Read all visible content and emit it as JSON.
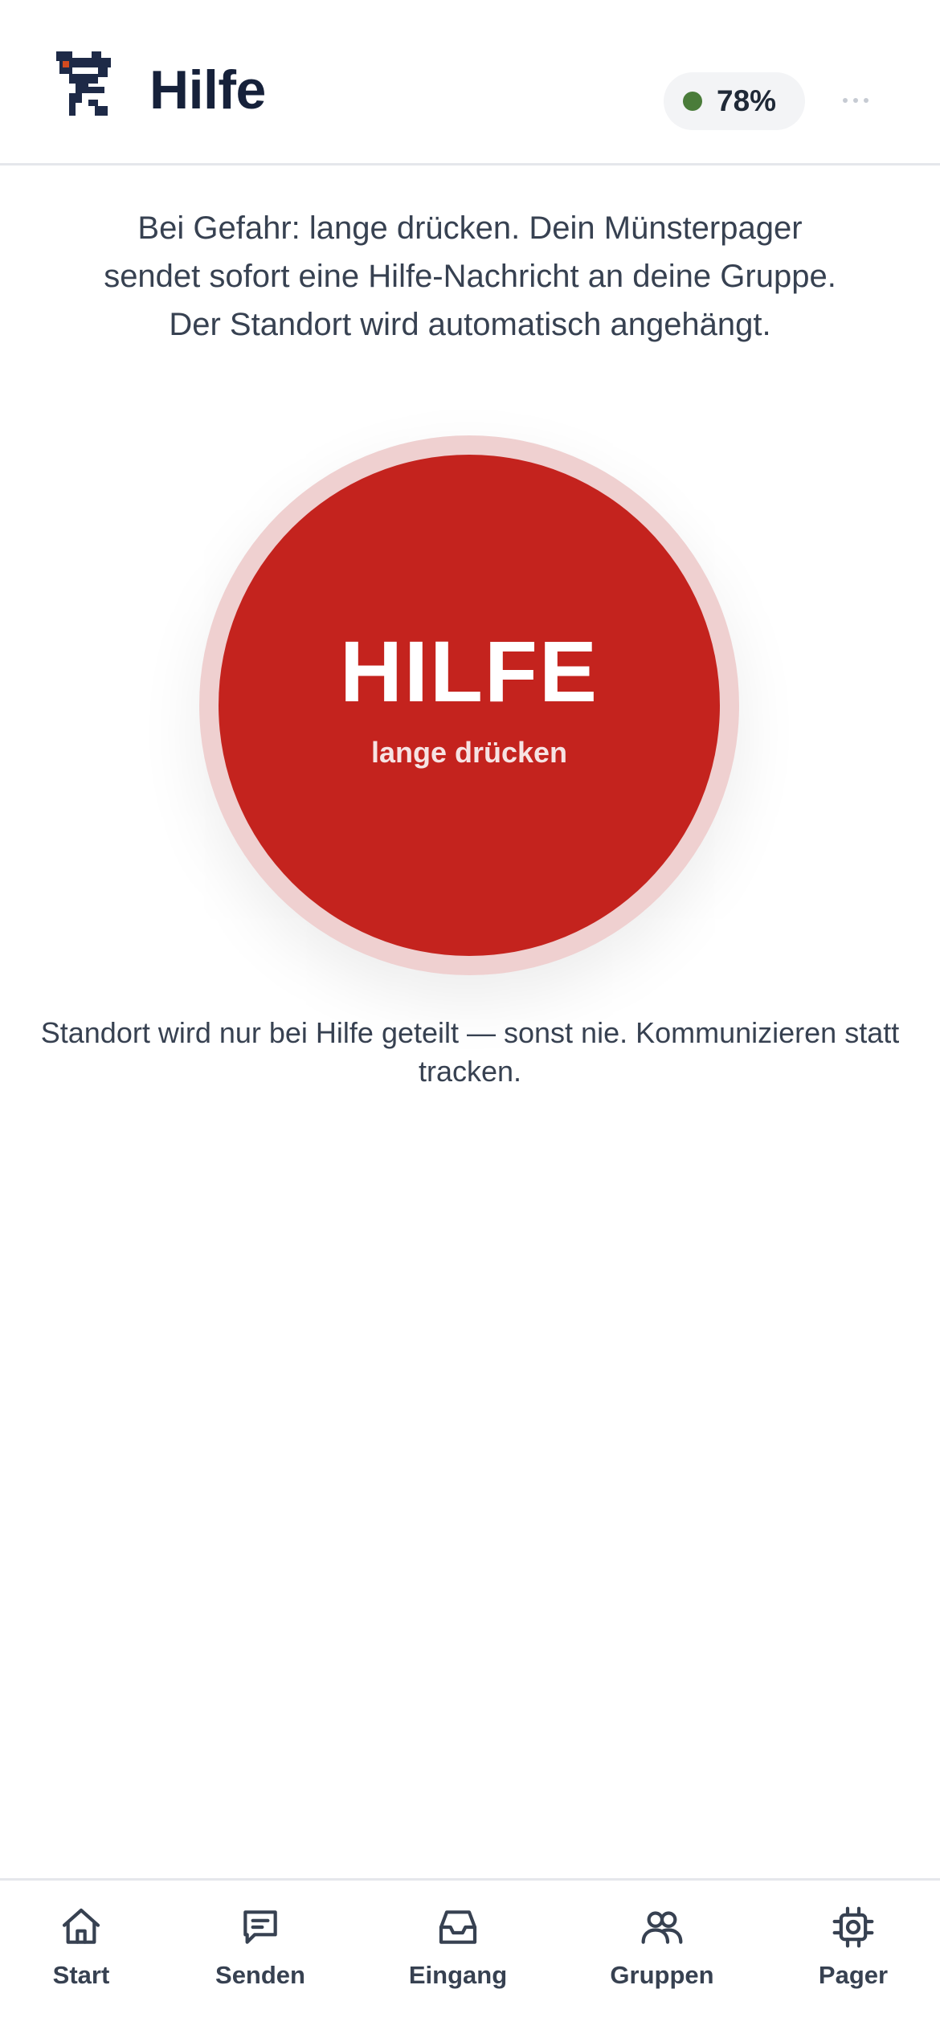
{
  "header": {
    "title": "Hilfe",
    "battery_percent": "78%",
    "battery_status_color": "#4a7c3a",
    "menu_icon": "more-horizontal-icon",
    "logo_icon": "pixel-runner-logo"
  },
  "intro": {
    "text": "Bei Gefahr: lange drücken. Dein Münsterpager sendet sofort eine Hilfe-Nachricht an deine Gruppe. Der Standort wird automatisch angehängt."
  },
  "help_button": {
    "label": "HILFE",
    "sublabel": "lange drücken",
    "color": "#c4231e"
  },
  "note": {
    "text": "Standort wird nur bei Hilfe geteilt — sonst nie. Kommunizieren statt tracken."
  },
  "nav": {
    "items": [
      {
        "label": "Start",
        "icon": "home-icon"
      },
      {
        "label": "Senden",
        "icon": "message-icon"
      },
      {
        "label": "Eingang",
        "icon": "inbox-icon"
      },
      {
        "label": "Gruppen",
        "icon": "users-icon"
      },
      {
        "label": "Pager",
        "icon": "chip-icon"
      }
    ]
  }
}
